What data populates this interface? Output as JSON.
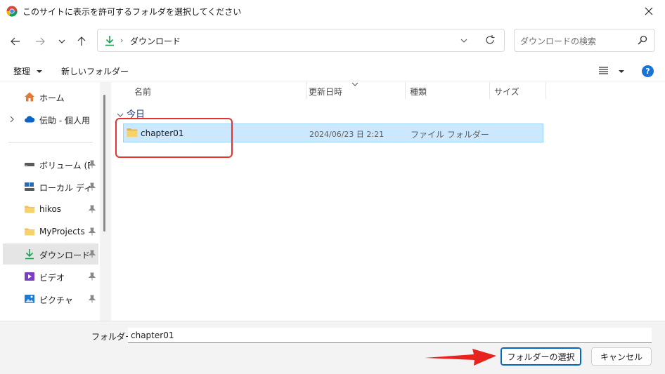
{
  "window": {
    "title": "このサイトに表示を許可するフォルダを選択してください"
  },
  "navbar": {
    "current_path": "ダウンロード",
    "search_placeholder": "ダウンロードの検索"
  },
  "toolbar": {
    "organize_label": "整理",
    "new_folder_label": "新しいフォルダー"
  },
  "sidebar": {
    "items": [
      {
        "label": "ホーム"
      },
      {
        "label": "伝助 - 個人用"
      },
      {
        "label": "ボリューム (D:)"
      },
      {
        "label": "ローカル ディスク"
      },
      {
        "label": "hikos"
      },
      {
        "label": "MyProjects"
      },
      {
        "label": "ダウンロード"
      },
      {
        "label": "ビデオ"
      },
      {
        "label": "ピクチャ"
      }
    ]
  },
  "columns": {
    "name": "名前",
    "date": "更新日時",
    "type": "種類",
    "size": "サイズ"
  },
  "groups": [
    {
      "label": "今日",
      "rows": [
        {
          "name": "chapter01",
          "date": "2024/06/23 日 2:21",
          "type": "ファイル フォルダー"
        }
      ]
    }
  ],
  "footer": {
    "folder_label": "フォルダー:",
    "folder_value": "chapter01",
    "select_button": "フォルダーの選択",
    "cancel_button": "キャンセル"
  },
  "colors": {
    "accent": "#0067c0",
    "selection": "#cce8ff",
    "annotation": "#e3342f"
  }
}
